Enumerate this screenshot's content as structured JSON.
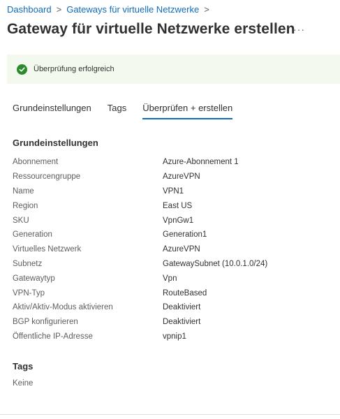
{
  "breadcrumb": {
    "items": [
      "Dashboard",
      "Gateways für virtuelle Netzwerke"
    ],
    "separator": ">"
  },
  "page": {
    "title": "Gateway für virtuelle Netzwerke erstellen",
    "more_label": "···"
  },
  "banner": {
    "text": "Überprüfung erfolgreich",
    "icon": "checkmark-circle-icon",
    "color": "#2b8a2b",
    "background": "#f3f9ee"
  },
  "tabs": [
    {
      "label": "Grundeinstellungen",
      "active": false
    },
    {
      "label": "Tags",
      "active": false
    },
    {
      "label": "Überprüfen + erstellen",
      "active": true
    }
  ],
  "basics": {
    "title": "Grundeinstellungen",
    "rows": [
      {
        "label": "Abonnement",
        "value": "Azure-Abonnement 1"
      },
      {
        "label": "Ressourcengruppe",
        "value": "AzureVPN"
      },
      {
        "label": "Name",
        "value": "VPN1"
      },
      {
        "label": "Region",
        "value": "East US"
      },
      {
        "label": "SKU",
        "value": "VpnGw1"
      },
      {
        "label": "Generation",
        "value": "Generation1"
      },
      {
        "label": "Virtuelles Netzwerk",
        "value": "AzureVPN"
      },
      {
        "label": "Subnetz",
        "value": "GatewaySubnet (10.0.1.0/24)"
      },
      {
        "label": "Gatewaytyp",
        "value": "Vpn"
      },
      {
        "label": "VPN-Typ",
        "value": "RouteBased"
      },
      {
        "label": "Aktiv/Aktiv-Modus aktivieren",
        "value": "Deaktiviert"
      },
      {
        "label": "BGP konfigurieren",
        "value": "Deaktiviert"
      },
      {
        "label": "Öffentliche IP-Adresse",
        "value": "vpnip1"
      }
    ]
  },
  "tags": {
    "title": "Tags",
    "value": "Keine"
  },
  "colors": {
    "accent": "#0f6cbd",
    "text": "#323130",
    "muted": "#605e5c"
  }
}
